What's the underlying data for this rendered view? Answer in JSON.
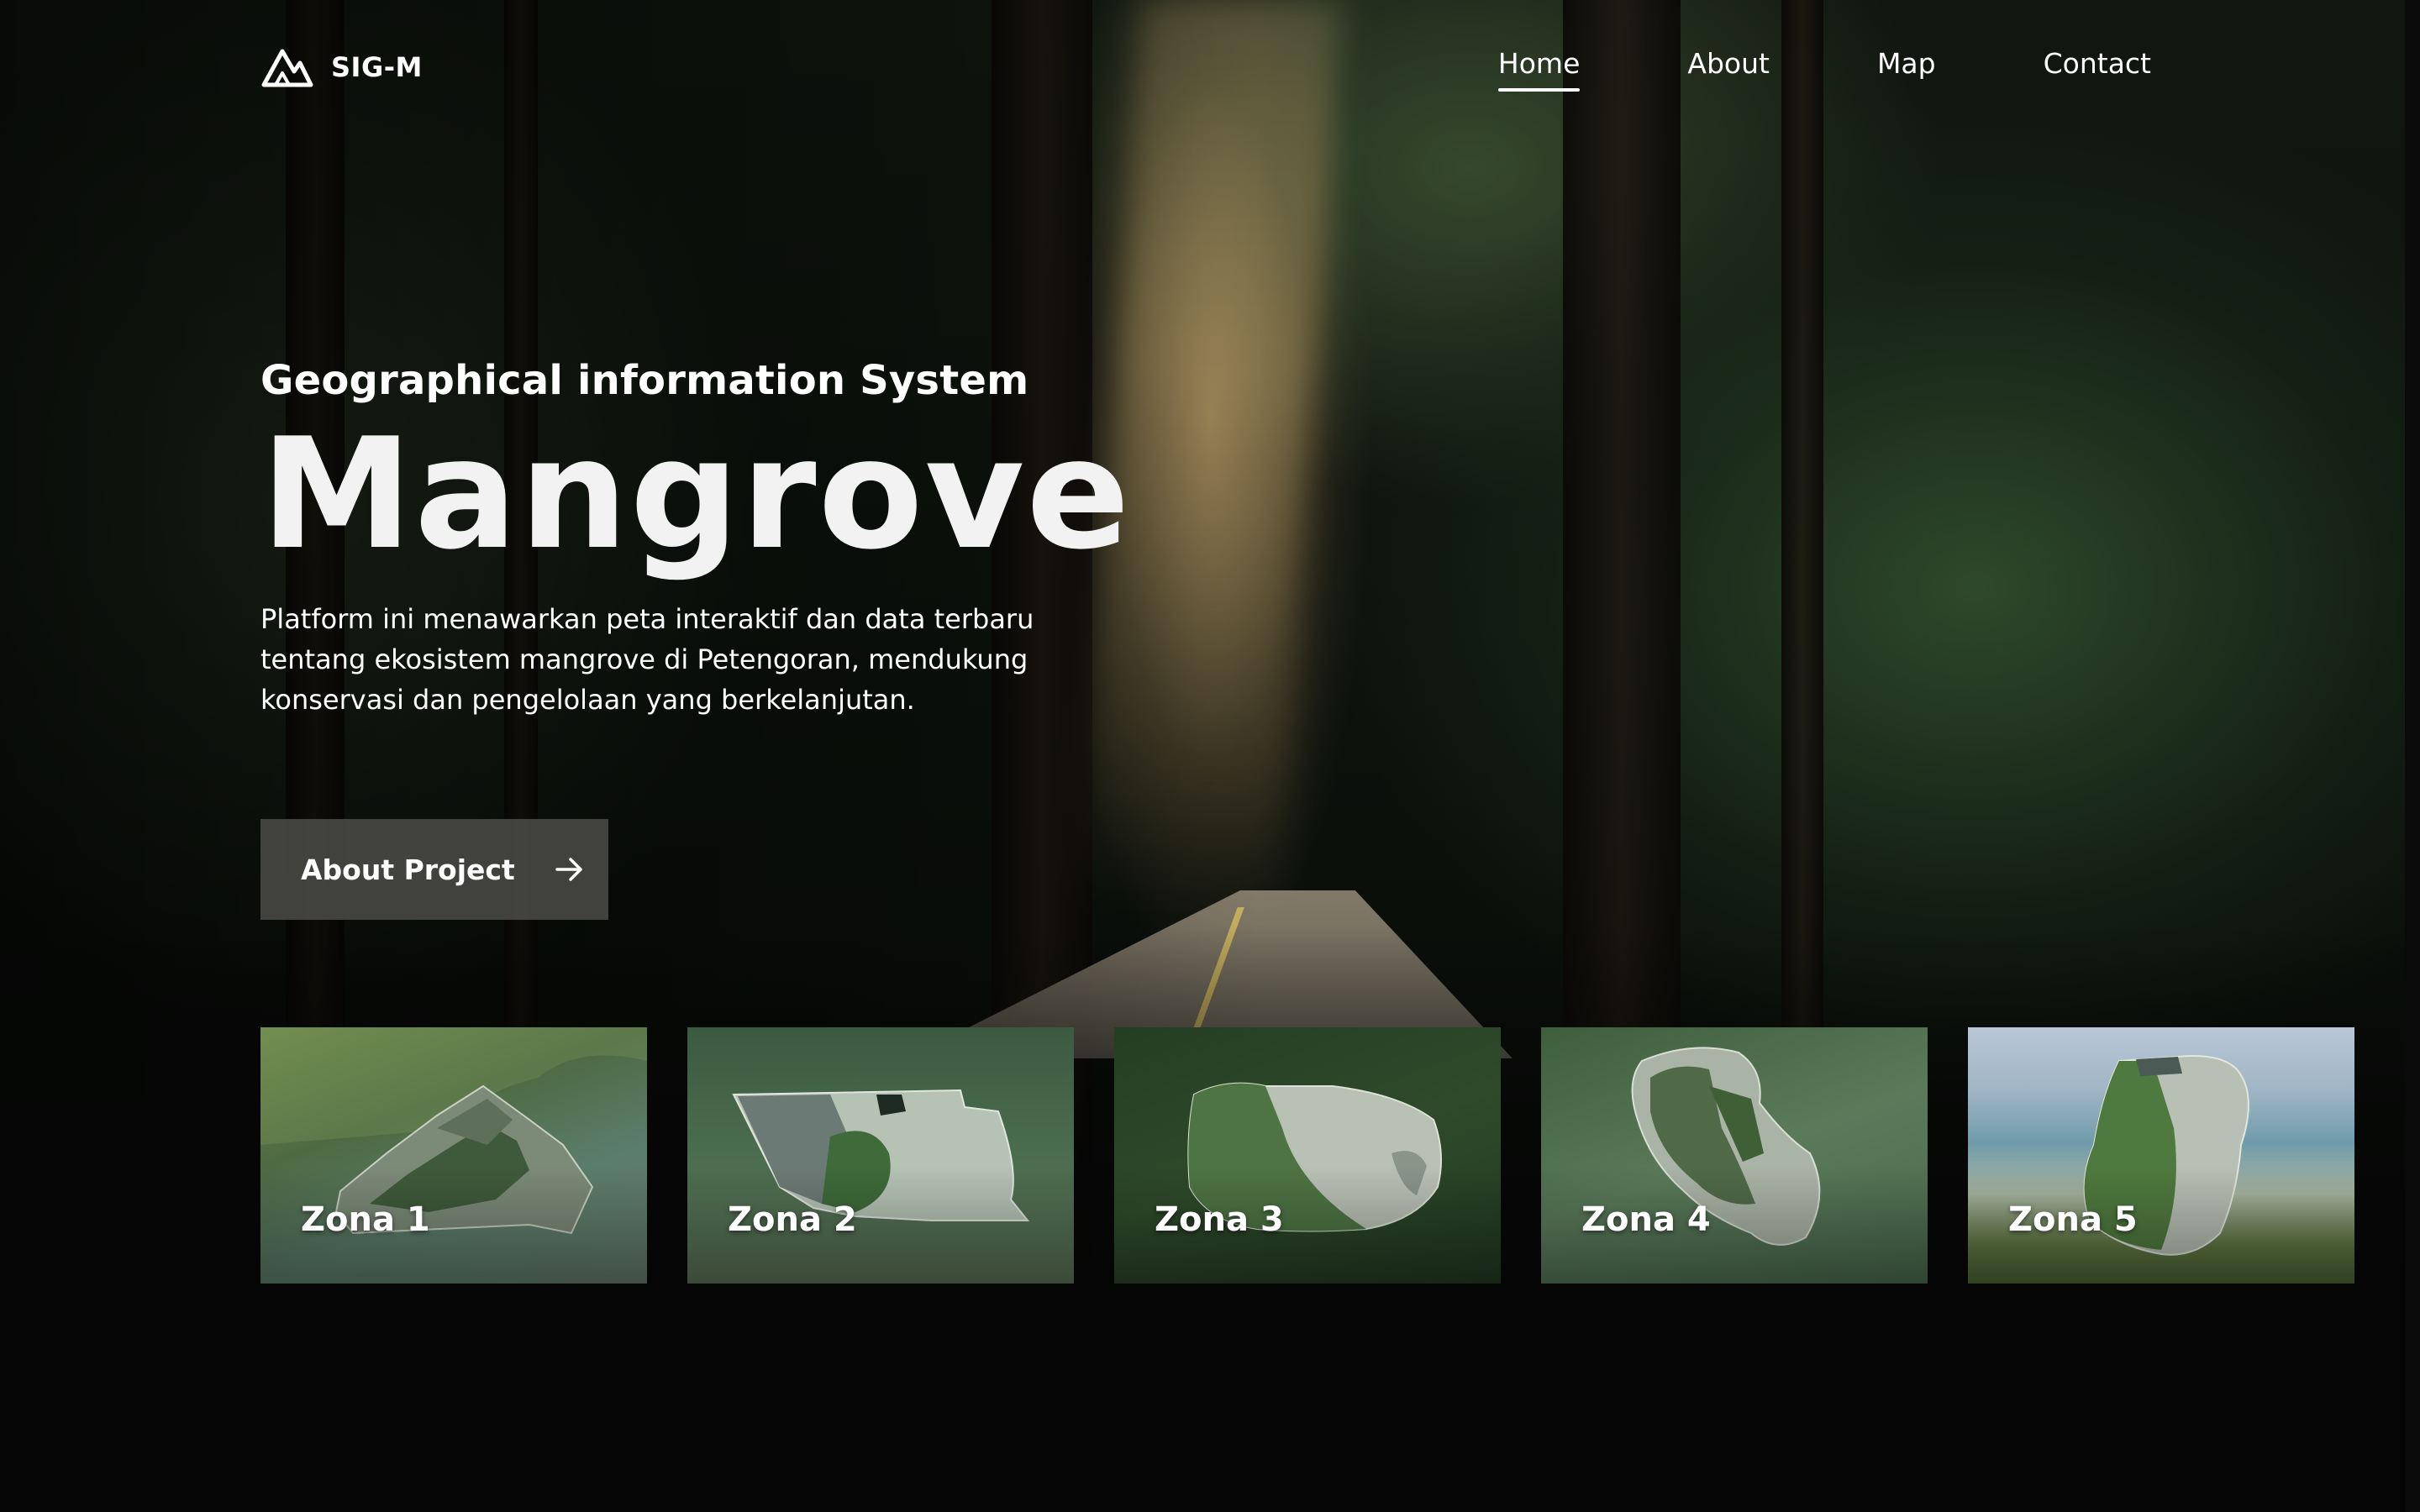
{
  "brand": {
    "name": "SIG-M",
    "logo_icon": "mountain-logo-icon"
  },
  "nav": {
    "items": [
      {
        "label": "Home",
        "active": true
      },
      {
        "label": "About",
        "active": false
      },
      {
        "label": "Map",
        "active": false
      },
      {
        "label": "Contact",
        "active": false
      }
    ]
  },
  "hero": {
    "subtitle": "Geographical information System",
    "title": "Mangrove",
    "description": "Platform ini menawarkan peta interaktif dan data terbaru tentang ekosistem mangrove di Petengoran, mendukung konservasi dan pengelolaan yang berkelanjutan.",
    "cta_label": "About Project",
    "cta_icon": "arrow-right-icon"
  },
  "zones": [
    {
      "label": "Zona 1"
    },
    {
      "label": "Zona 2"
    },
    {
      "label": "Zona 3"
    },
    {
      "label": "Zona 4"
    },
    {
      "label": "Zona 5"
    }
  ]
}
